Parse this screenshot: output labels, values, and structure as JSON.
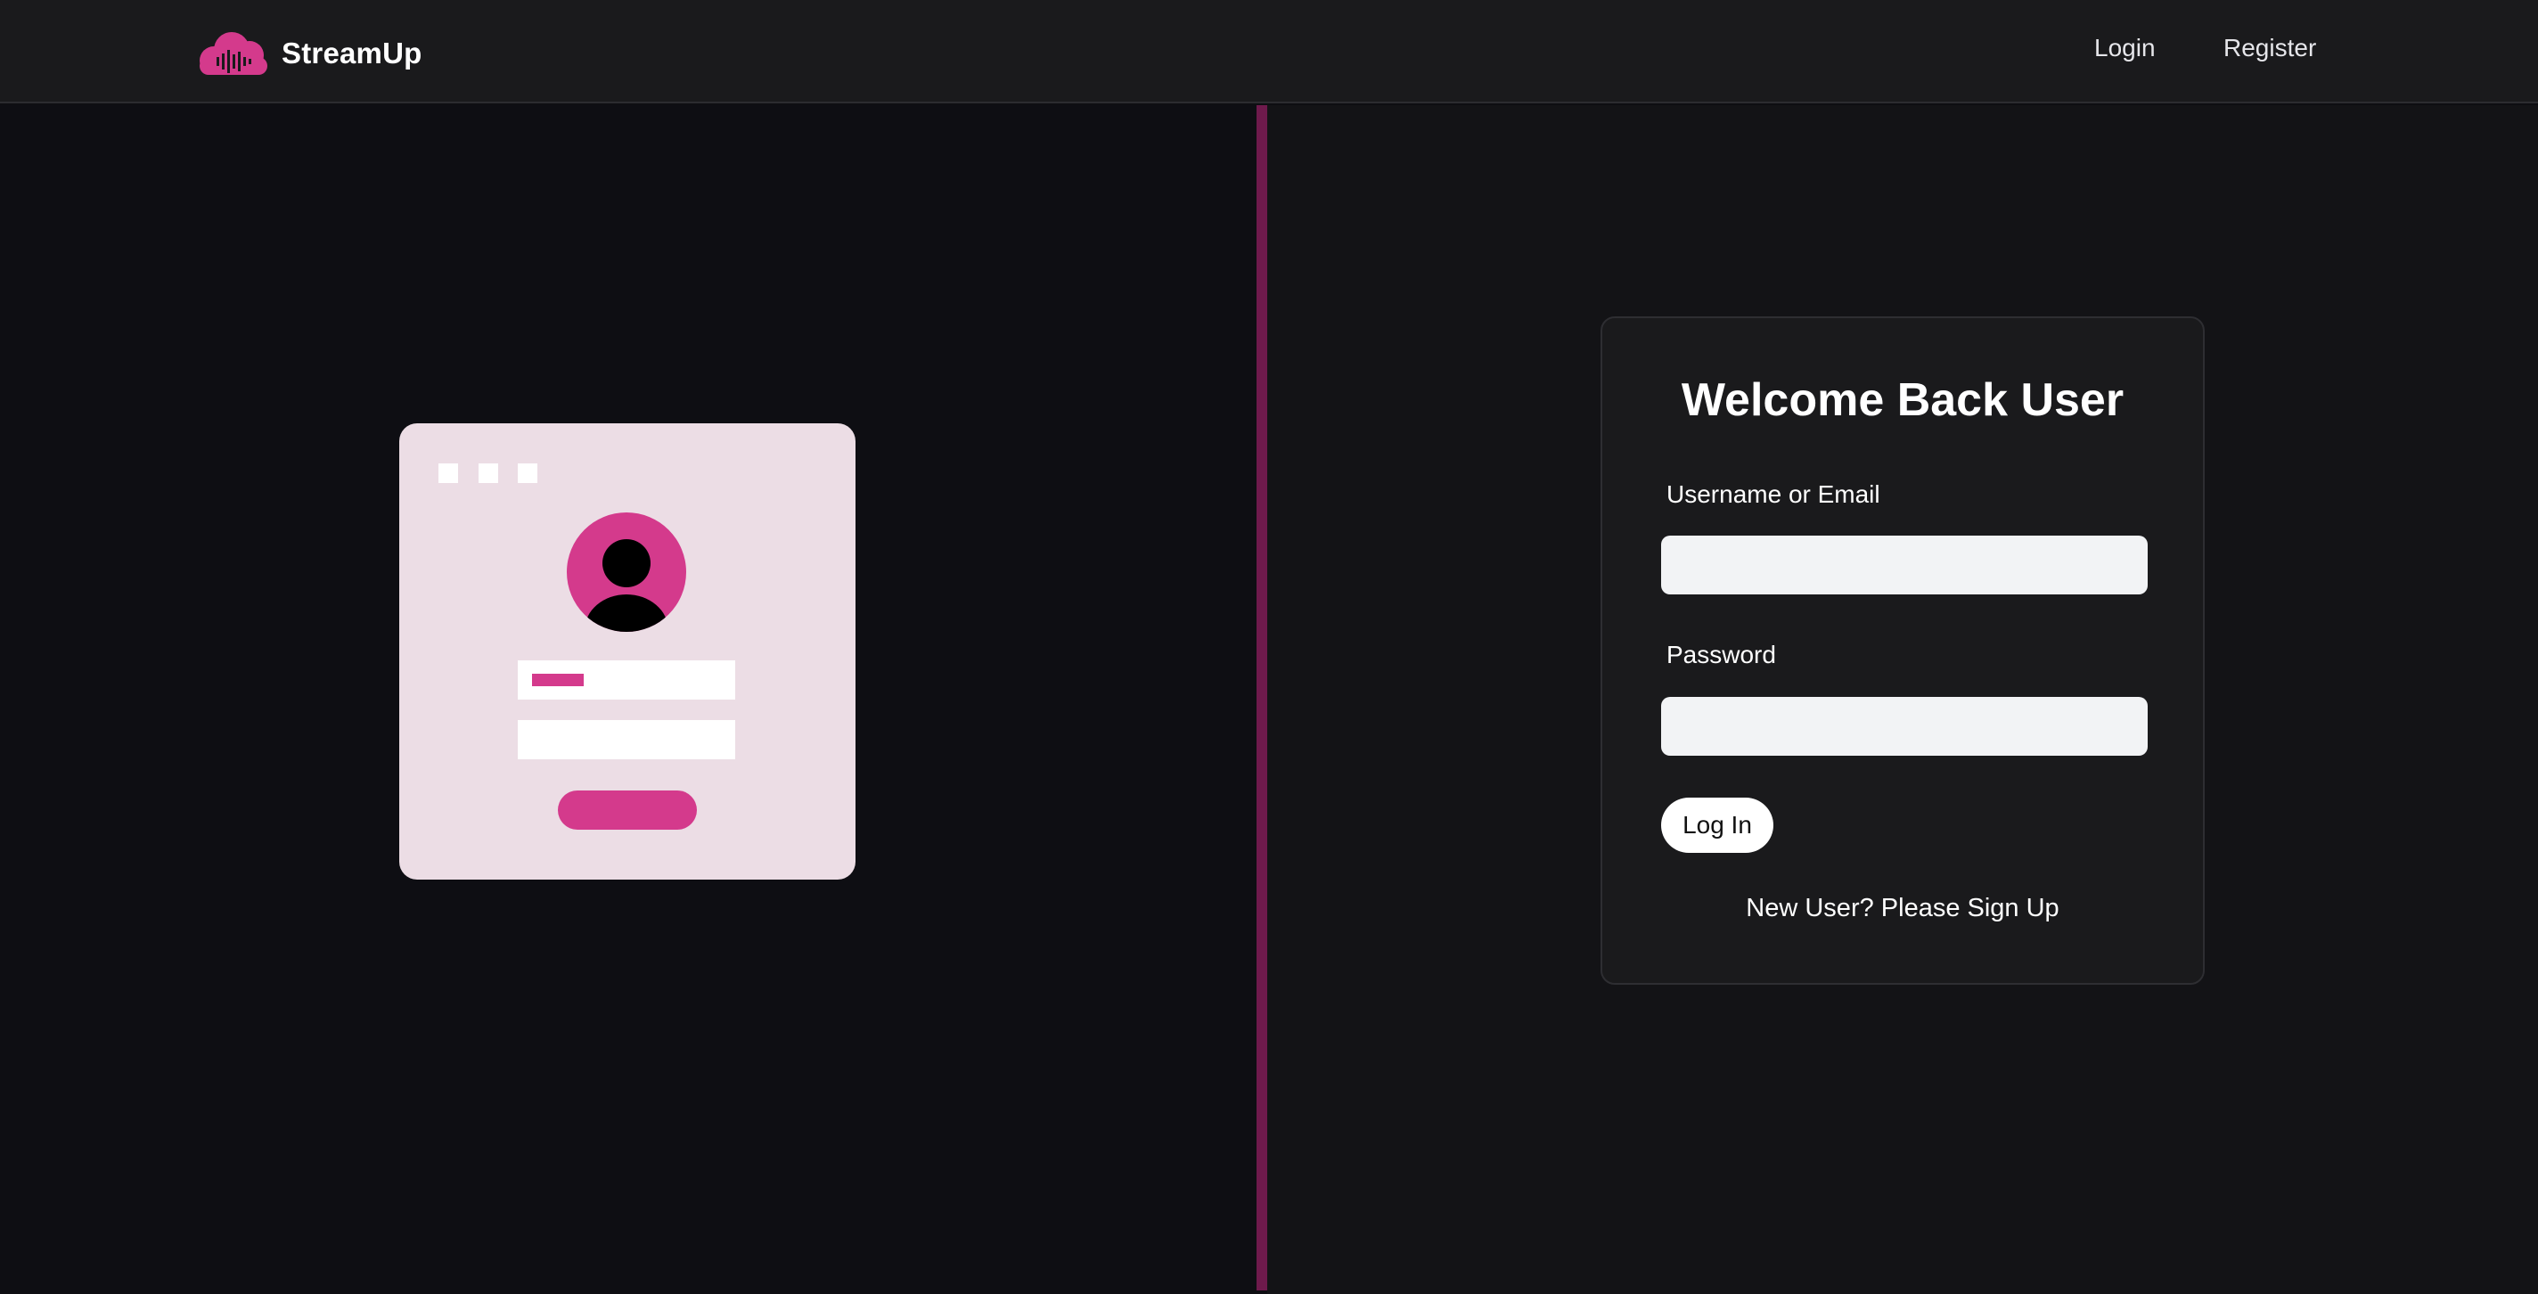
{
  "brand": {
    "name": "StreamUp",
    "logo_icon": "cloud-soundwave-icon",
    "accent_color": "#d43a8c"
  },
  "nav": {
    "login": "Login",
    "register": "Register"
  },
  "illustration": {
    "icon": "login-illustration-icon",
    "background_color": "#ecdde5"
  },
  "login_card": {
    "title": "Welcome Back User",
    "username_label": "Username or Email",
    "username_value": "",
    "password_label": "Password",
    "password_value": "",
    "submit_label": "Log In",
    "signup_text": "New User? Please Sign Up"
  },
  "colors": {
    "header_bg": "#1a1a1c",
    "left_bg": "#0e0e13",
    "divider": "#6e1a4c",
    "right_bg": "#131316",
    "card_bg": "#1a1a1c"
  }
}
